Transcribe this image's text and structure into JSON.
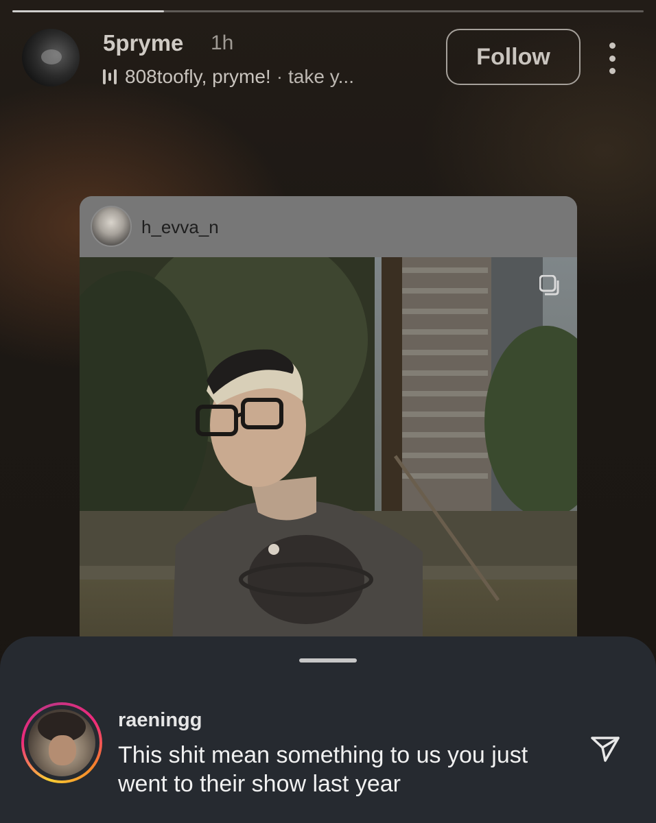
{
  "story": {
    "progress_fraction": 0.24,
    "username": "5pryme",
    "time_ago": "1h",
    "music": {
      "icon": "audio-bars-icon",
      "artist": "808toofly, pryme!",
      "separator": "·",
      "song": "take y..."
    },
    "follow_label": "Follow",
    "more_icon": "more-vertical-icon"
  },
  "shared_post": {
    "username": "h_evva_n",
    "multi_media_icon": "carousel-icon"
  },
  "reply": {
    "username": "raeningg",
    "text": "This shit mean something to us you just went to their show last year",
    "send_icon": "send-icon"
  },
  "colors": {
    "story_ring": [
      "#f9ce34",
      "#ee2a7b",
      "#c13584"
    ],
    "sheet_background": "#262a30"
  }
}
